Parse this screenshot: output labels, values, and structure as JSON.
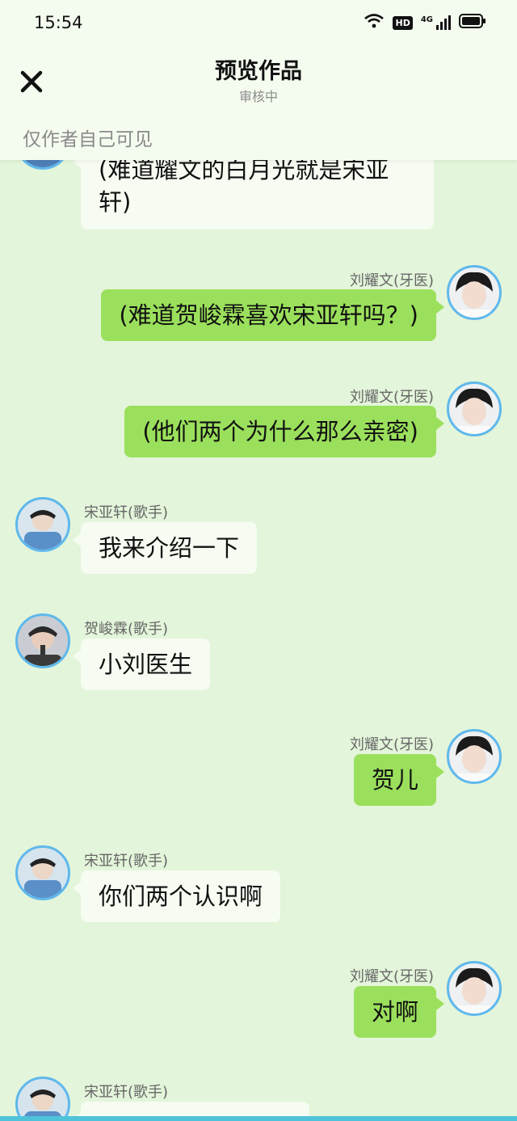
{
  "status": {
    "time": "15:54",
    "hd": "HD",
    "net": "4G"
  },
  "nav": {
    "title": "预览作品",
    "subtitle": "审核中"
  },
  "visibility": "仅作者自己可见",
  "messages": [
    {
      "side": "left",
      "sender": "",
      "text": "(难道耀文的白月光就是宋亚轩)",
      "avatar": "avatar-song"
    },
    {
      "side": "right",
      "sender": "刘耀文(牙医)",
      "text": "(难道贺峻霖喜欢宋亚轩吗？)",
      "avatar": "avatar-liu"
    },
    {
      "side": "right",
      "sender": "刘耀文(牙医)",
      "text": "(他们两个为什么那么亲密)",
      "avatar": "avatar-liu"
    },
    {
      "side": "left",
      "sender": "宋亚轩(歌手)",
      "text": "我来介绍一下",
      "avatar": "avatar-song"
    },
    {
      "side": "left",
      "sender": "贺峻霖(歌手)",
      "text": "小刘医生",
      "avatar": "avatar-he"
    },
    {
      "side": "right",
      "sender": "刘耀文(牙医)",
      "text": "贺儿",
      "avatar": "avatar-liu"
    },
    {
      "side": "left",
      "sender": "宋亚轩(歌手)",
      "text": "你们两个认识啊",
      "avatar": "avatar-song"
    },
    {
      "side": "right",
      "sender": "刘耀文(牙医)",
      "text": "对啊",
      "avatar": "avatar-liu"
    },
    {
      "side": "left",
      "sender": "宋亚轩(歌手)",
      "text": "",
      "avatar": "avatar-song"
    }
  ],
  "colors": {
    "background": "#e3f5da",
    "right_bubble": "#9be05c",
    "left_bubble": "#f6fcf2",
    "avatar_ring": "#5fb8ec"
  }
}
